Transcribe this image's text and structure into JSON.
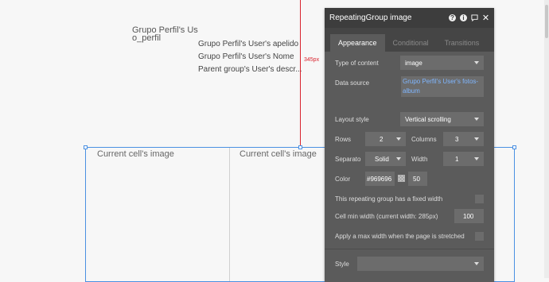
{
  "canvas": {
    "profile_fragment_1": "Grupo Perfil's Us",
    "profile_fragment_2": "o_perfil",
    "text_lines": [
      "Grupo Perfil's User's apelido",
      "Grupo Perfil's User's Nome",
      "Parent group's User's descr..."
    ],
    "guide_label": "345px",
    "cells": [
      "Current cell's image",
      "Current cell's image"
    ]
  },
  "panel": {
    "title": "RepeatingGroup image",
    "icons": [
      "help-icon",
      "info-icon",
      "comment-icon",
      "close-icon"
    ],
    "tabs": [
      "Appearance",
      "Conditional",
      "Transitions"
    ],
    "active_tab": "Appearance",
    "type_of_content": {
      "label": "Type of content",
      "value": "image"
    },
    "data_source": {
      "label": "Data source",
      "value": "Grupo Perfil's User's fotos-album"
    },
    "layout_style": {
      "label": "Layout style",
      "value": "Vertical scrolling"
    },
    "rows": {
      "label": "Rows",
      "value": "2"
    },
    "columns": {
      "label": "Columns",
      "value": "3"
    },
    "separator": {
      "label": "Separato",
      "value": "Solid"
    },
    "width": {
      "label": "Width",
      "value": "1"
    },
    "color": {
      "label": "Color",
      "value": "#969696",
      "opacity": "50"
    },
    "fixed_width": {
      "label": "This repeating group has a fixed width",
      "checked": false
    },
    "cell_min_width": {
      "label": "Cell min width (current width: 285px)",
      "value": "100"
    },
    "max_width": {
      "label": "Apply a max width when the page is stretched",
      "checked": false
    },
    "style": {
      "label": "Style",
      "value": ""
    }
  },
  "colors": {
    "accent_blue": "#4a90e2",
    "guide_red": "#d9232e",
    "panel_bg": "#5b5b5b",
    "header_bg": "#3d3d3d",
    "link_blue": "#7fb6ff"
  }
}
